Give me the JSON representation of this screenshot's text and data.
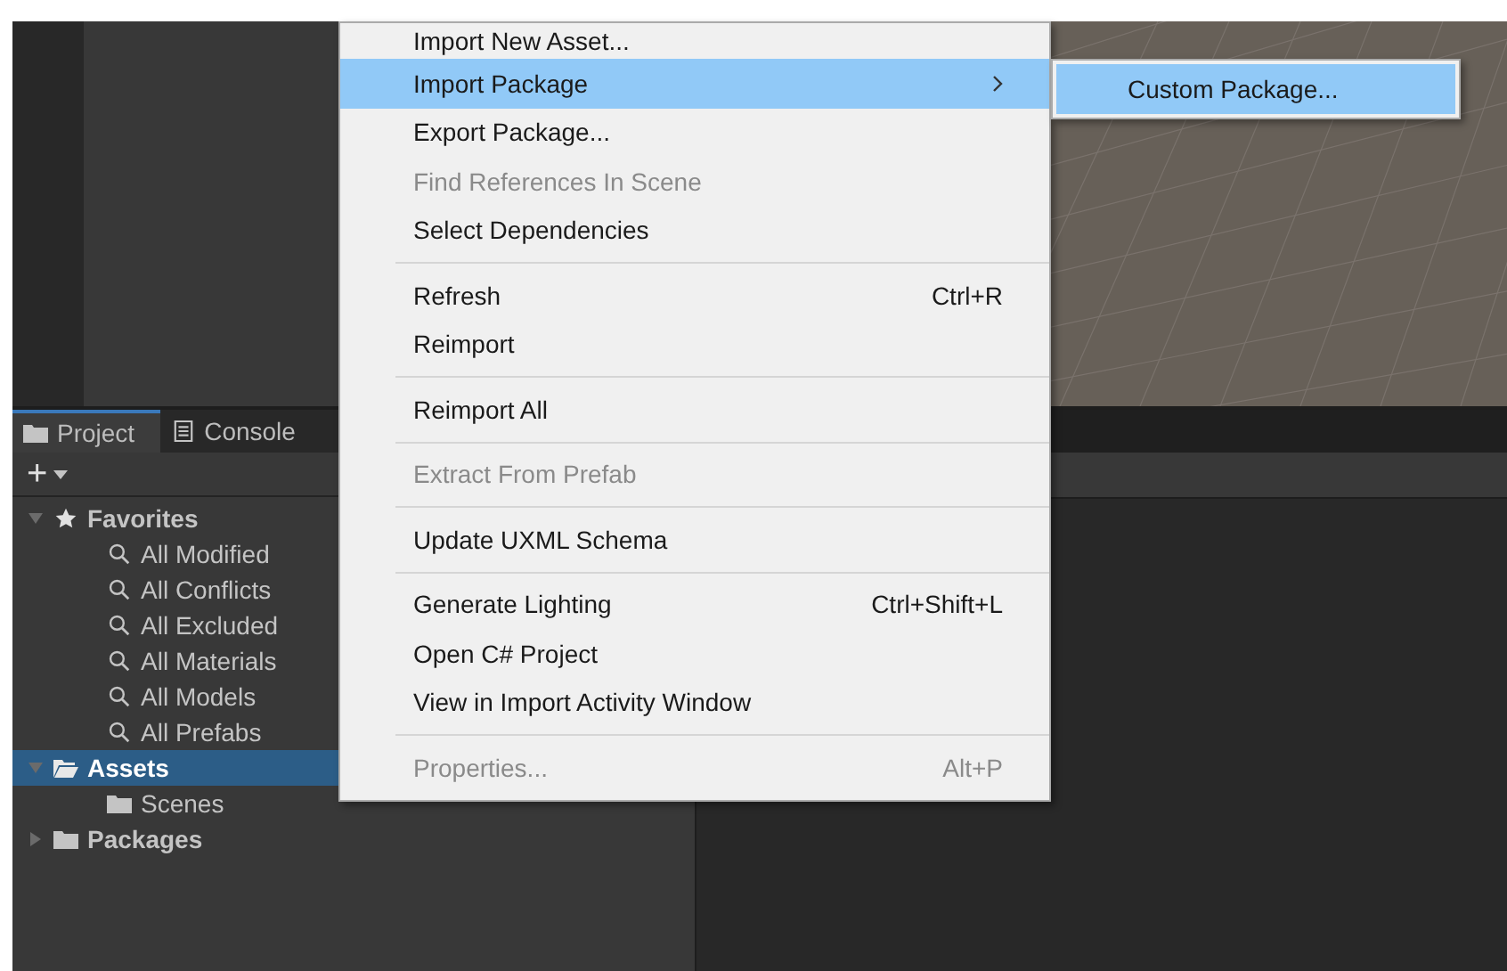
{
  "panel_tabs": [
    {
      "label": "Project",
      "kind": "folder",
      "selected": true
    },
    {
      "label": "Console",
      "kind": "console",
      "selected": false
    }
  ],
  "toolbar": {
    "add_button": "+"
  },
  "tree": [
    {
      "label": "Favorites",
      "kind": "favorites",
      "expanded": true,
      "selected": false,
      "children": [
        {
          "label": "All Modified",
          "kind": "search",
          "selected": false
        },
        {
          "label": "All Conflicts",
          "kind": "search",
          "selected": false
        },
        {
          "label": "All Excluded",
          "kind": "search",
          "selected": false
        },
        {
          "label": "All Materials",
          "kind": "search",
          "selected": false
        },
        {
          "label": "All Models",
          "kind": "search",
          "selected": false
        },
        {
          "label": "All Prefabs",
          "kind": "search",
          "selected": false
        }
      ]
    },
    {
      "label": "Assets",
      "kind": "folder",
      "expanded": true,
      "selected": true,
      "children": [
        {
          "label": "Scenes",
          "kind": "folder",
          "selected": false
        }
      ]
    },
    {
      "label": "Packages",
      "kind": "folder",
      "expanded": false,
      "selected": false
    }
  ],
  "context_menu": [
    {
      "kind": "item",
      "label": "Import New Asset...",
      "disabled": false,
      "selected": false
    },
    {
      "kind": "item",
      "label": "Import Package",
      "disabled": false,
      "selected": true,
      "submenu": true
    },
    {
      "kind": "item",
      "label": "Export Package...",
      "disabled": false,
      "selected": false
    },
    {
      "kind": "item",
      "label": "Find References In Scene",
      "disabled": true,
      "selected": false
    },
    {
      "kind": "item",
      "label": "Select Dependencies",
      "disabled": false,
      "selected": false
    },
    {
      "kind": "separator"
    },
    {
      "kind": "item",
      "label": "Refresh",
      "shortcut": "Ctrl+R",
      "disabled": false,
      "selected": false
    },
    {
      "kind": "item",
      "label": "Reimport",
      "disabled": false,
      "selected": false
    },
    {
      "kind": "separator"
    },
    {
      "kind": "item",
      "label": "Reimport All",
      "disabled": false,
      "selected": false
    },
    {
      "kind": "separator"
    },
    {
      "kind": "item",
      "label": "Extract From Prefab",
      "disabled": true,
      "selected": false
    },
    {
      "kind": "separator"
    },
    {
      "kind": "item",
      "label": "Update UXML Schema",
      "disabled": false,
      "selected": false
    },
    {
      "kind": "separator"
    },
    {
      "kind": "item",
      "label": "Generate Lighting",
      "shortcut": "Ctrl+Shift+L",
      "disabled": false,
      "selected": false
    },
    {
      "kind": "item",
      "label": "Open C# Project",
      "disabled": false,
      "selected": false
    },
    {
      "kind": "item",
      "label": "View in Import Activity Window",
      "disabled": false,
      "selected": false
    },
    {
      "kind": "separator"
    },
    {
      "kind": "item",
      "label": "Properties...",
      "shortcut": "Alt+P",
      "disabled": true,
      "selected": false
    }
  ],
  "submenu": [
    {
      "label": "Custom Package...",
      "selected": true
    }
  ]
}
